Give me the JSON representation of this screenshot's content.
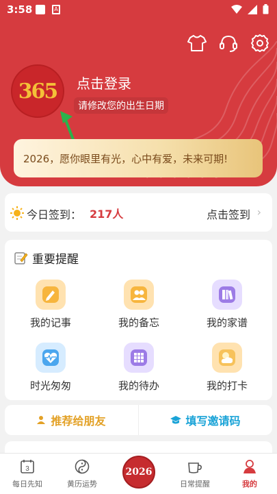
{
  "status_bar": {
    "time": "3:58"
  },
  "header": {
    "login_text": "点击登录",
    "birth_hint": "请修改您的出生日期",
    "avatar_text": "365",
    "banner_text": "2026，愿你眼里有光，心中有爱，未来可期!"
  },
  "checkin": {
    "label": "今日签到：",
    "count": "217人",
    "action": "点击签到"
  },
  "reminders": {
    "title": "重要提醒",
    "items": [
      {
        "label": "我的记事",
        "icon": "pen-icon"
      },
      {
        "label": "我的备忘",
        "icon": "people-icon"
      },
      {
        "label": "我的家谱",
        "icon": "books-icon"
      },
      {
        "label": "时光匆匆",
        "icon": "heartbeat-icon"
      },
      {
        "label": "我的待办",
        "icon": "grid-icon"
      },
      {
        "label": "我的打卡",
        "icon": "weather-icon"
      }
    ]
  },
  "share": {
    "recommend": "推荐给朋友",
    "invite": "填写邀请码"
  },
  "bottom_nav": {
    "items": [
      {
        "label": "每日先知",
        "icon": "calendar-icon"
      },
      {
        "label": "黄历运势",
        "icon": "yinyang-icon"
      },
      {
        "label": "2026",
        "icon": "center-logo"
      },
      {
        "label": "日常提醒",
        "icon": "cup-icon"
      },
      {
        "label": "我的",
        "icon": "user-icon"
      }
    ],
    "calendar_day": "3"
  },
  "colors": {
    "brand_red": "#d63b3f",
    "gold": "#e3a126",
    "blue": "#1aa3d7"
  }
}
